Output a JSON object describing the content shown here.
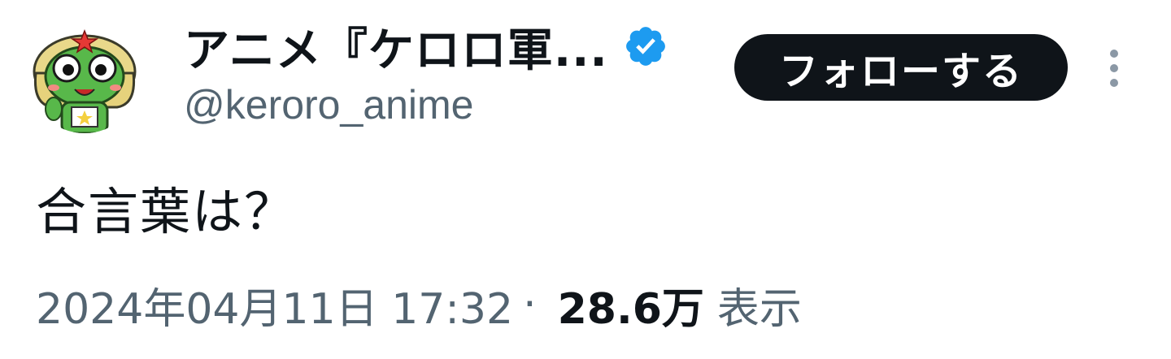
{
  "author": {
    "display_name": "アニメ『ケロロ軍...",
    "handle": "@keroro_anime",
    "verified": true,
    "badge_color": "#1d9bf0"
  },
  "actions": {
    "follow_label": "フォローする",
    "more_icon": "more-vertical-icon"
  },
  "tweet": {
    "text": "合言葉は？"
  },
  "meta": {
    "timestamp": "2024年04月11日 17:32",
    "separator": "·",
    "views_count": "28.6万",
    "views_label": "表示"
  },
  "colors": {
    "text_primary": "#0f1419",
    "text_secondary": "#536471",
    "button_bg": "#0f1419",
    "button_text": "#ffffff"
  }
}
